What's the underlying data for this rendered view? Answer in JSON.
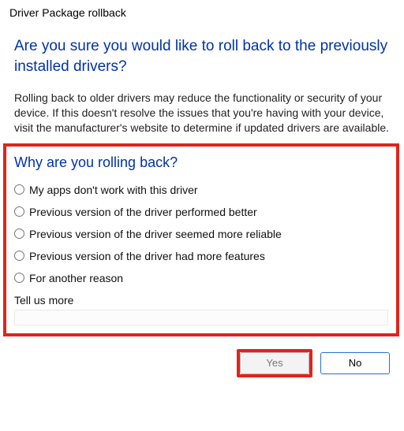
{
  "titlebar": "Driver Package rollback",
  "heading": "Are you sure you would like to roll back to the previously installed drivers?",
  "warning": "Rolling back to older drivers may reduce the functionality or security of your device. If this doesn't resolve the issues that you're having with your device, visit the manufacturer's website to determine if updated drivers are available.",
  "section_heading": "Why are you rolling back?",
  "reasons": [
    "My apps don't work with this driver",
    "Previous version of the driver performed better",
    "Previous version of the driver seemed more reliable",
    "Previous version of the driver had more features",
    "For another reason"
  ],
  "tell_us_more_label": "Tell us more",
  "tell_us_more_value": "",
  "buttons": {
    "yes": "Yes",
    "no": "No"
  },
  "highlight": {
    "color": "#e2231a"
  },
  "accent": "#0033aa"
}
